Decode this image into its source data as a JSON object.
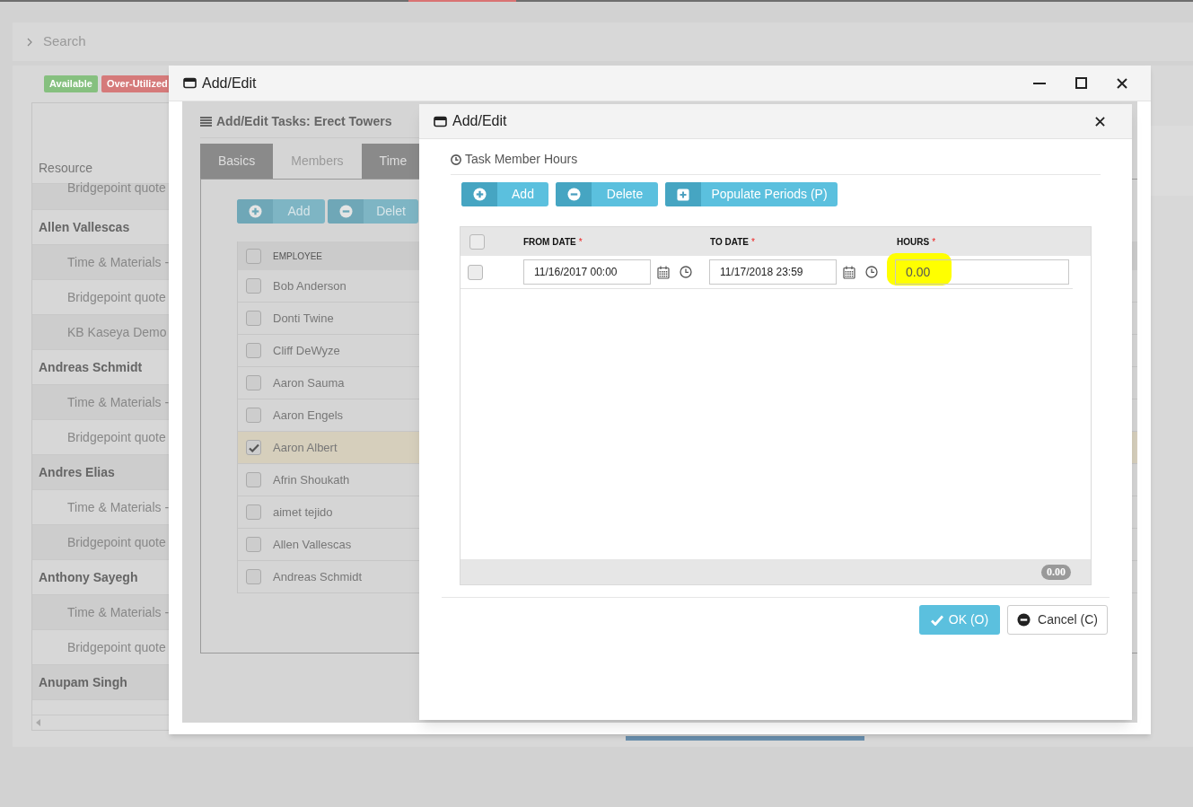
{
  "search": {
    "placeholder": "Search"
  },
  "legend": [
    {
      "label": "Available",
      "color": "#86c07f"
    },
    {
      "label": "Over-Utilized",
      "color": "#d57a7a"
    }
  ],
  "resource_grid": {
    "column": "Resource",
    "rows": [
      {
        "kind": "detail",
        "label": "Bridgepoint quote"
      },
      {
        "kind": "person",
        "label": "Allen Vallescas"
      },
      {
        "kind": "detail",
        "label": "Time & Materials -"
      },
      {
        "kind": "detail",
        "label": "Bridgepoint quote"
      },
      {
        "kind": "detail",
        "label": "KB Kaseya Demo"
      },
      {
        "kind": "person",
        "label": "Andreas Schmidt"
      },
      {
        "kind": "detail",
        "label": "Time & Materials -"
      },
      {
        "kind": "detail",
        "label": "Bridgepoint quote"
      },
      {
        "kind": "person",
        "label": "Andres Elias"
      },
      {
        "kind": "detail",
        "label": "Time & Materials -"
      },
      {
        "kind": "detail",
        "label": "Bridgepoint quote"
      },
      {
        "kind": "person",
        "label": "Anthony Sayegh"
      },
      {
        "kind": "detail",
        "label": "Time & Materials -"
      },
      {
        "kind": "detail",
        "label": "Bridgepoint quote"
      },
      {
        "kind": "person",
        "label": "Anupam Singh"
      }
    ]
  },
  "outer_dialog": {
    "title": "Add/Edit",
    "heading": "Add/Edit Tasks: Erect Towers",
    "tabs": [
      {
        "label": "Basics",
        "selected": false
      },
      {
        "label": "Members",
        "selected": true
      },
      {
        "label": "Time",
        "selected": false
      }
    ],
    "buttons": [
      {
        "kind": "add",
        "label": "Add"
      },
      {
        "kind": "delete",
        "label": "Delet"
      }
    ],
    "employee_table": {
      "column": "EMPLOYEE",
      "all_checked": false,
      "rows": [
        {
          "name": "Bob Anderson",
          "checked": false
        },
        {
          "name": "Donti Twine",
          "checked": false
        },
        {
          "name": "Cliff DeWyze",
          "checked": false
        },
        {
          "name": "Aaron Sauma",
          "checked": false
        },
        {
          "name": "Aaron Engels",
          "checked": false
        },
        {
          "name": "Aaron Albert",
          "checked": true
        },
        {
          "name": "Afrin Shoukath",
          "checked": false
        },
        {
          "name": "aimet tejido",
          "checked": false
        },
        {
          "name": "Allen Vallescas",
          "checked": false
        },
        {
          "name": "Andreas Schmidt",
          "checked": false
        }
      ]
    }
  },
  "inner_dialog": {
    "title": "Add/Edit",
    "section": "Task Member Hours",
    "buttons": [
      {
        "kind": "add",
        "label": "Add"
      },
      {
        "kind": "delete",
        "label": "Delete"
      },
      {
        "kind": "populate",
        "label": "Populate Periods (P)"
      }
    ],
    "grid": {
      "all_checked": false,
      "columns": [
        {
          "label": "FROM DATE",
          "required_mark": "*"
        },
        {
          "label": "TO DATE",
          "required_mark": "*"
        },
        {
          "label": "HOURS",
          "required_mark": "*"
        }
      ],
      "rows": [
        {
          "checked": false,
          "from": "11/16/2017 00:00",
          "to": "11/17/2018 23:59",
          "hours": "0.00",
          "hours_highlighted": true
        }
      ],
      "total": "0.00"
    },
    "actions": [
      {
        "kind": "ok",
        "label": "OK (O)"
      },
      {
        "kind": "cancel",
        "label": "Cancel (C)"
      }
    ]
  }
}
